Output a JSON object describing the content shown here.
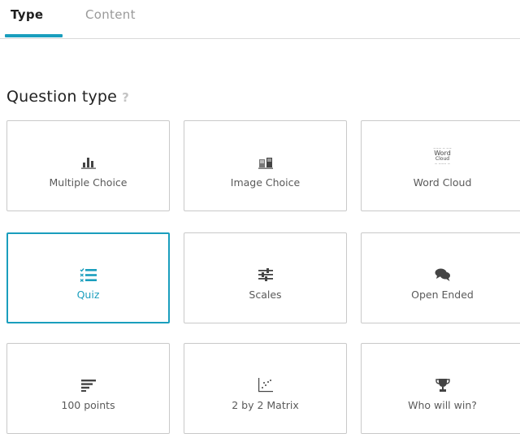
{
  "tabs": [
    {
      "label": "Type",
      "active": true
    },
    {
      "label": "Content",
      "active": false
    }
  ],
  "section": {
    "title": "Question type",
    "help": "?"
  },
  "question_types": [
    {
      "label": "Multiple Choice",
      "icon": "bar-chart-icon"
    },
    {
      "label": "Image Choice",
      "icon": "image-choice-icon"
    },
    {
      "label": "Word Cloud",
      "icon": "word-cloud-icon"
    },
    {
      "label": "Quiz",
      "icon": "quiz-list-icon",
      "selected": true
    },
    {
      "label": "Scales",
      "icon": "sliders-icon"
    },
    {
      "label": "Open Ended",
      "icon": "speech-bubbles-icon"
    },
    {
      "label": "100 points",
      "icon": "points-lines-icon"
    },
    {
      "label": "2 by 2 Matrix",
      "icon": "matrix-scatter-icon"
    },
    {
      "label": "Who will win?",
      "icon": "trophy-icon"
    }
  ],
  "word_cloud_icon_text": {
    "line1": "Word",
    "line2": "Cloud"
  },
  "colors": {
    "accent": "#1a9ebd",
    "icon": "#444444",
    "border": "#c9c9c9"
  }
}
